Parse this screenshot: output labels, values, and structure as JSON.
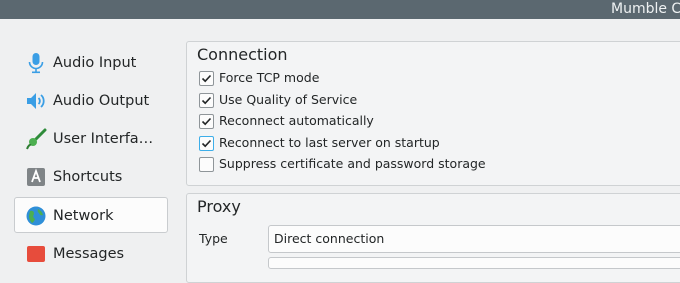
{
  "window": {
    "title": "Mumble C"
  },
  "sidebar": {
    "items": [
      {
        "label": "Audio Input",
        "icon": "microphone-icon",
        "selected": false
      },
      {
        "label": "Audio Output",
        "icon": "speaker-icon",
        "selected": false
      },
      {
        "label": "User Interfa…",
        "icon": "brush-icon",
        "selected": false
      },
      {
        "label": "Shortcuts",
        "icon": "keyboard-key-icon",
        "selected": false
      },
      {
        "label": "Network",
        "icon": "globe-icon",
        "selected": true
      },
      {
        "label": "Messages",
        "icon": "messages-icon",
        "selected": false
      }
    ]
  },
  "connection": {
    "title": "Connection",
    "options": [
      {
        "label": "Force TCP mode",
        "checked": true
      },
      {
        "label": "Use Quality of Service",
        "checked": true
      },
      {
        "label": "Reconnect automatically",
        "checked": true
      },
      {
        "label": "Reconnect to last server on startup",
        "checked": true
      },
      {
        "label": "Suppress certificate and password storage",
        "checked": false
      }
    ]
  },
  "proxy": {
    "title": "Proxy",
    "type_label": "Type",
    "type_value": "Direct connection"
  },
  "colors": {
    "accent": "#3daee9",
    "titlebar": "#5b6870"
  }
}
